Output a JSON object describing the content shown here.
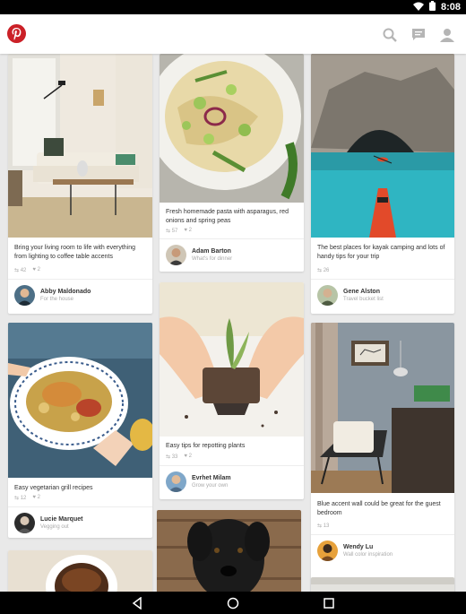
{
  "status": {
    "time": "8:08"
  },
  "app": {
    "name": "Pinterest"
  },
  "pins": [
    {
      "description": "Bring your living room to life with everything from lighting to coffee table accents",
      "repins": "42",
      "likes": "2",
      "user": "Abby Maldonado",
      "board": "For the house"
    },
    {
      "description": "Fresh homemade pasta with asparagus, red onions and spring peas",
      "repins": "57",
      "likes": "2",
      "user": "Adam Barton",
      "board": "What's for dinner"
    },
    {
      "description": "The best places for kayak camping and lots of handy tips for your trip",
      "repins": "26",
      "likes": "",
      "user": "Gene Alston",
      "board": "Travel bucket list"
    },
    {
      "description": "Easy vegetarian grill recipes",
      "repins": "12",
      "likes": "2",
      "user": "Lucie Marquet",
      "board": "Vegging out"
    },
    {
      "description": "Easy tips for repotting plants",
      "repins": "33",
      "likes": "2",
      "user": "Evrhet Milam",
      "board": "Grow your own"
    },
    {
      "description": "Blue accent wall could be great for the guest bedroom",
      "repins": "13",
      "likes": "",
      "user": "Wendy Lu",
      "board": "Wall color inspiration"
    }
  ],
  "icons": {
    "logo": "pinterest-logo",
    "search": "search-icon",
    "messages": "messages-icon",
    "profile": "profile-icon",
    "back": "back-icon",
    "home": "home-icon",
    "recents": "recents-icon"
  }
}
